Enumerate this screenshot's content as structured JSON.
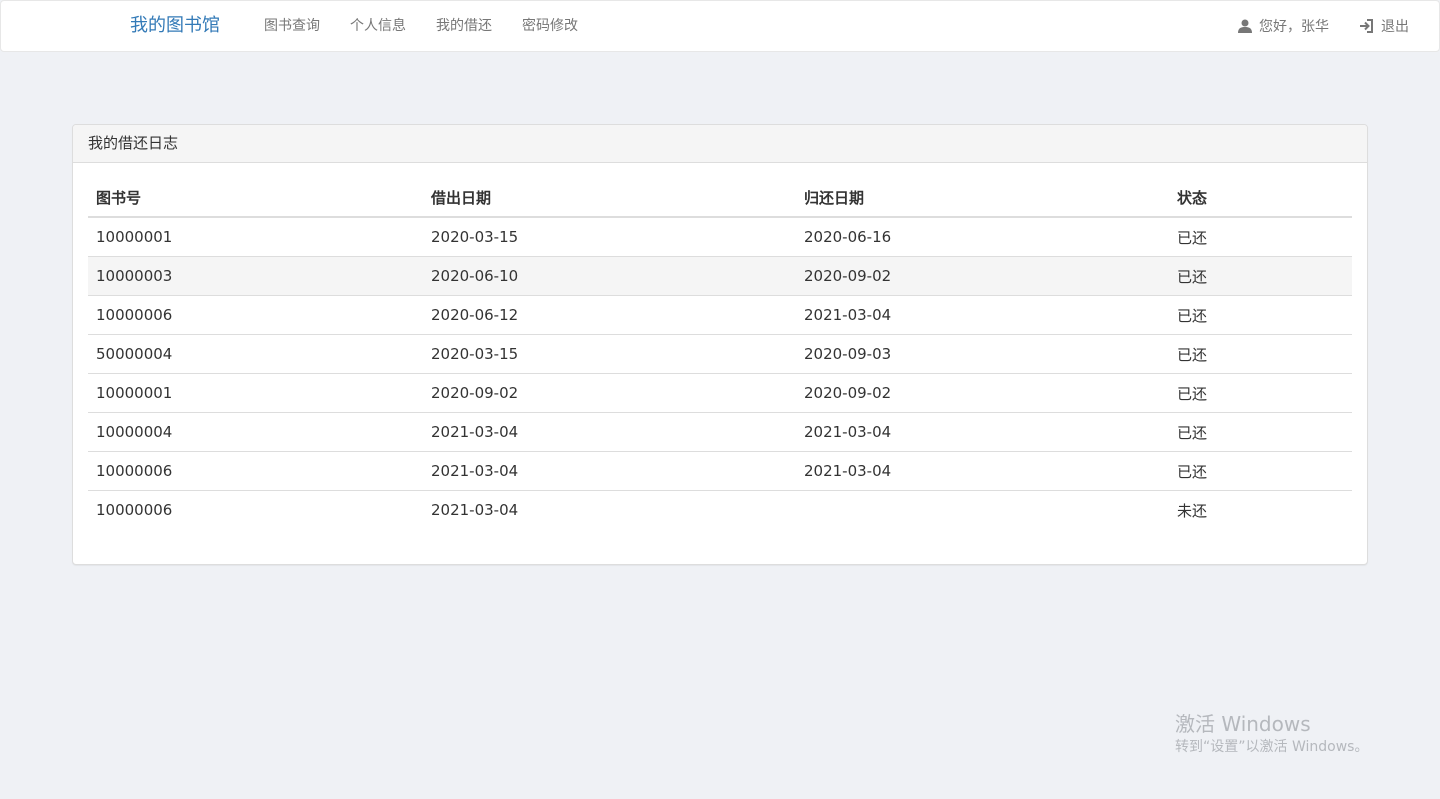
{
  "navbar": {
    "brand": "我的图书馆",
    "links": [
      "图书查询",
      "个人信息",
      "我的借还",
      "密码修改"
    ],
    "greeting": "您好，张华",
    "logout": "退出"
  },
  "panel": {
    "title": "我的借还日志",
    "columns": [
      "图书号",
      "借出日期",
      "归还日期",
      "状态"
    ],
    "rows": [
      [
        "10000001",
        "2020-03-15",
        "2020-06-16",
        "已还"
      ],
      [
        "10000003",
        "2020-06-10",
        "2020-09-02",
        "已还"
      ],
      [
        "10000006",
        "2020-06-12",
        "2021-03-04",
        "已还"
      ],
      [
        "50000004",
        "2020-03-15",
        "2020-09-03",
        "已还"
      ],
      [
        "10000001",
        "2020-09-02",
        "2020-09-02",
        "已还"
      ],
      [
        "10000004",
        "2021-03-04",
        "2021-03-04",
        "已还"
      ],
      [
        "10000006",
        "2021-03-04",
        "2021-03-04",
        "已还"
      ],
      [
        "10000006",
        "2021-03-04",
        "",
        "未还"
      ]
    ]
  },
  "watermark": {
    "title": "激活 Windows",
    "subtitle": "转到“设置”以激活 Windows。"
  }
}
